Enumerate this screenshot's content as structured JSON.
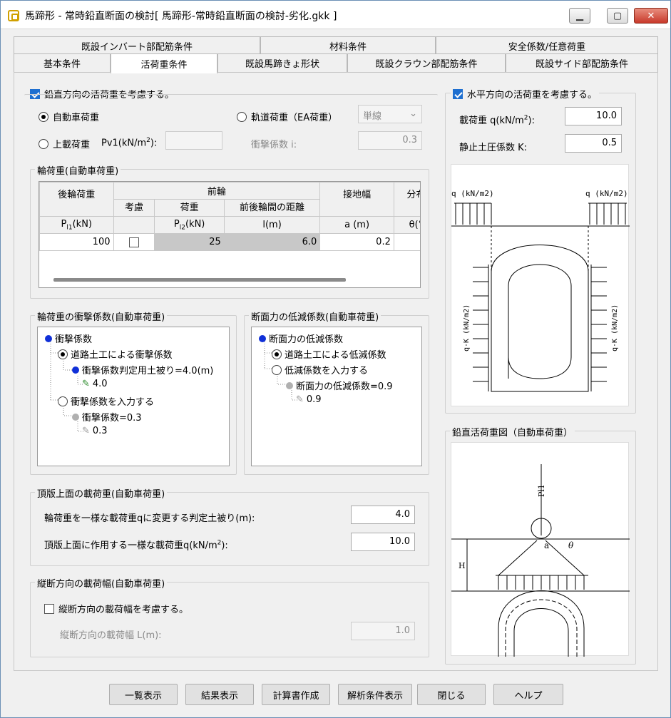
{
  "window": {
    "title": "馬蹄形 - 常時鉛直断面の検討[ 馬蹄形-常時鉛直断面の検討-劣化.gkk ]"
  },
  "tabs_row1": [
    "既設インバート部配筋条件",
    "材料条件",
    "安全係数/任意荷重"
  ],
  "tabs_row2": [
    "基本条件",
    "活荷重条件",
    "既設馬蹄きょ形状",
    "既設クラウン部配筋条件",
    "既設サイド部配筋条件"
  ],
  "vertical": {
    "consider_label": "鉛直方向の活荷重を考慮する。",
    "auto_load": "自動車荷重",
    "rail_load": "軌道荷重（EA荷重）",
    "rail_select": "単線",
    "top_load": "上載荷重",
    "pv1_label": "Pv1(kN/m",
    "pv1_sup": "2",
    "pv1_close": "):",
    "impact_i_label": "衝撃係数 i:",
    "impact_i_value": "0.3"
  },
  "wheel": {
    "group_label": "輪荷重(自動車荷重)",
    "h_rear": "後輪荷重",
    "h_front": "前輪",
    "h_contact": "接地幅",
    "h_dist": "分布",
    "h_consider": "考慮",
    "h_load": "荷重",
    "h_distance": "前後輪間の距離",
    "u_p1": "P",
    "u_p1_sub": "l1",
    "u_p1_unit": "(kN)",
    "u_p2": "P",
    "u_p2_sub": "l2",
    "u_p2_unit": "(kN)",
    "u_l": "l(m)",
    "u_a": "a (m)",
    "u_theta": "θ(°",
    "v_p1": "100",
    "v_p2": "25",
    "v_l": "6.0",
    "v_a": "0.2"
  },
  "impact_tree": {
    "group_label": "輪荷重の衝撃係数(自動車荷重)",
    "root": "衝撃係数",
    "opt1": "道路土工による衝撃係数",
    "opt1_child": "衝撃係数判定用土被り=4.0(m)",
    "opt1_val": "4.0",
    "opt2": "衝撃係数を入力する",
    "opt2_child": "衝撃係数=0.3",
    "opt2_val": "0.3"
  },
  "reduce_tree": {
    "group_label": "断面力の低減係数(自動車荷重)",
    "root": "断面力の低減係数",
    "opt1": "道路土工による低減係数",
    "opt2": "低減係数を入力する",
    "opt2_child": "断面力の低減係数=0.9",
    "opt2_val": "0.9"
  },
  "top_slab": {
    "group_label": "頂版上面の載荷重(自動車荷重)",
    "row1_label": "輪荷重を一様な載荷重qに変更する判定土被り(m):",
    "row1_value": "4.0",
    "row2_label": "頂版上面に作用する一様な載荷重q(kN/m",
    "row2_sup": "2",
    "row2_close": "):",
    "row2_value": "10.0"
  },
  "longitudinal": {
    "group_label": "縦断方向の載荷幅(自動車荷重)",
    "consider_label": "縦断方向の載荷幅を考慮する。",
    "width_label": "縦断方向の載荷幅 L(m):",
    "width_value": "1.0"
  },
  "horizontal": {
    "consider_label": "水平方向の活荷重を考慮する。",
    "q_label": "載荷重 q(kN/m",
    "q_sup": "2",
    "q_close": "):",
    "q_value": "10.0",
    "k_label": "静止土圧係数 K:",
    "k_value": "0.5",
    "fig_q_left": "q (kN/m2)",
    "fig_q_right": "q (kN/m2)",
    "fig_qk_left": "q·K (kN/m2)",
    "fig_qk_right": "q·K (kN/m2)"
  },
  "vertical_fig": {
    "group_label": "鉛直活荷重図（自動車荷重）",
    "p_label": "Pl1",
    "a_label": "a",
    "theta_label": "θ",
    "h_label": "H"
  },
  "buttons": [
    "一覧表示",
    "結果表示",
    "計算書作成",
    "解析条件表示",
    "閉じる",
    "ヘルプ"
  ]
}
